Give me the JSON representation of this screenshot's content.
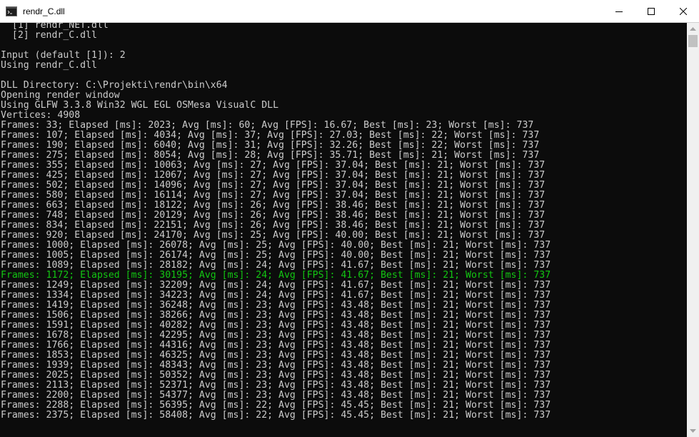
{
  "window": {
    "title": "rendr_C.dll",
    "icon": "console-icon",
    "controls": [
      "minimize-icon",
      "maximize-icon",
      "close-icon"
    ]
  },
  "colors": {
    "background": "#0c0c0c",
    "text": "#cccccc",
    "highlight": "#13c613"
  },
  "console": {
    "highlight_line_index": 25,
    "lines": [
      "  [1] rendr_NET.dll",
      "  [2] rendr_C.dll",
      "",
      "Input (default [1]): 2",
      "Using rendr_C.dll",
      "",
      "DLL Directory: C:\\Projekti\\rendr\\bin\\x64",
      "Opening render window",
      "Using GLFW 3.3.8 Win32 WGL EGL OSMesa VisualC DLL",
      "Vertices: 4908",
      "Frames: 33; Elapsed [ms]: 2023; Avg [ms]: 60; Avg [FPS]: 16.67; Best [ms]: 23; Worst [ms]: 737",
      "Frames: 107; Elapsed [ms]: 4034; Avg [ms]: 37; Avg [FPS]: 27.03; Best [ms]: 22; Worst [ms]: 737",
      "Frames: 190; Elapsed [ms]: 6040; Avg [ms]: 31; Avg [FPS]: 32.26; Best [ms]: 22; Worst [ms]: 737",
      "Frames: 275; Elapsed [ms]: 8054; Avg [ms]: 28; Avg [FPS]: 35.71; Best [ms]: 21; Worst [ms]: 737",
      "Frames: 355; Elapsed [ms]: 10063; Avg [ms]: 27; Avg [FPS]: 37.04; Best [ms]: 21; Worst [ms]: 737",
      "Frames: 425; Elapsed [ms]: 12067; Avg [ms]: 27; Avg [FPS]: 37.04; Best [ms]: 21; Worst [ms]: 737",
      "Frames: 502; Elapsed [ms]: 14096; Avg [ms]: 27; Avg [FPS]: 37.04; Best [ms]: 21; Worst [ms]: 737",
      "Frames: 580; Elapsed [ms]: 16114; Avg [ms]: 27; Avg [FPS]: 37.04; Best [ms]: 21; Worst [ms]: 737",
      "Frames: 663; Elapsed [ms]: 18122; Avg [ms]: 26; Avg [FPS]: 38.46; Best [ms]: 21; Worst [ms]: 737",
      "Frames: 748; Elapsed [ms]: 20129; Avg [ms]: 26; Avg [FPS]: 38.46; Best [ms]: 21; Worst [ms]: 737",
      "Frames: 834; Elapsed [ms]: 22151; Avg [ms]: 26; Avg [FPS]: 38.46; Best [ms]: 21; Worst [ms]: 737",
      "Frames: 920; Elapsed [ms]: 24170; Avg [ms]: 25; Avg [FPS]: 40.00; Best [ms]: 21; Worst [ms]: 737",
      "Frames: 1000; Elapsed [ms]: 26078; Avg [ms]: 25; Avg [FPS]: 40.00; Best [ms]: 21; Worst [ms]: 737",
      "Frames: 1005; Elapsed [ms]: 26174; Avg [ms]: 25; Avg [FPS]: 40.00; Best [ms]: 21; Worst [ms]: 737",
      "Frames: 1089; Elapsed [ms]: 28182; Avg [ms]: 24; Avg [FPS]: 41.67; Best [ms]: 21; Worst [ms]: 737",
      "Frames: 1172; Elapsed [ms]: 30195; Avg [ms]: 24; Avg [FPS]: 41.67; Best [ms]: 21; Worst [ms]: 737",
      "Frames: 1249; Elapsed [ms]: 32209; Avg [ms]: 24; Avg [FPS]: 41.67; Best [ms]: 21; Worst [ms]: 737",
      "Frames: 1334; Elapsed [ms]: 34223; Avg [ms]: 24; Avg [FPS]: 41.67; Best [ms]: 21; Worst [ms]: 737",
      "Frames: 1419; Elapsed [ms]: 36248; Avg [ms]: 23; Avg [FPS]: 43.48; Best [ms]: 21; Worst [ms]: 737",
      "Frames: 1506; Elapsed [ms]: 38266; Avg [ms]: 23; Avg [FPS]: 43.48; Best [ms]: 21; Worst [ms]: 737",
      "Frames: 1591; Elapsed [ms]: 40282; Avg [ms]: 23; Avg [FPS]: 43.48; Best [ms]: 21; Worst [ms]: 737",
      "Frames: 1678; Elapsed [ms]: 42295; Avg [ms]: 23; Avg [FPS]: 43.48; Best [ms]: 21; Worst [ms]: 737",
      "Frames: 1766; Elapsed [ms]: 44316; Avg [ms]: 23; Avg [FPS]: 43.48; Best [ms]: 21; Worst [ms]: 737",
      "Frames: 1853; Elapsed [ms]: 46325; Avg [ms]: 23; Avg [FPS]: 43.48; Best [ms]: 21; Worst [ms]: 737",
      "Frames: 1939; Elapsed [ms]: 48343; Avg [ms]: 23; Avg [FPS]: 43.48; Best [ms]: 21; Worst [ms]: 737",
      "Frames: 2025; Elapsed [ms]: 50352; Avg [ms]: 23; Avg [FPS]: 43.48; Best [ms]: 21; Worst [ms]: 737",
      "Frames: 2113; Elapsed [ms]: 52371; Avg [ms]: 23; Avg [FPS]: 43.48; Best [ms]: 21; Worst [ms]: 737",
      "Frames: 2200; Elapsed [ms]: 54377; Avg [ms]: 23; Avg [FPS]: 43.48; Best [ms]: 21; Worst [ms]: 737",
      "Frames: 2288; Elapsed [ms]: 56395; Avg [ms]: 22; Avg [FPS]: 45.45; Best [ms]: 21; Worst [ms]: 737",
      "Frames: 2375; Elapsed [ms]: 58408; Avg [ms]: 22; Avg [FPS]: 45.45; Best [ms]: 21; Worst [ms]: 737"
    ]
  }
}
